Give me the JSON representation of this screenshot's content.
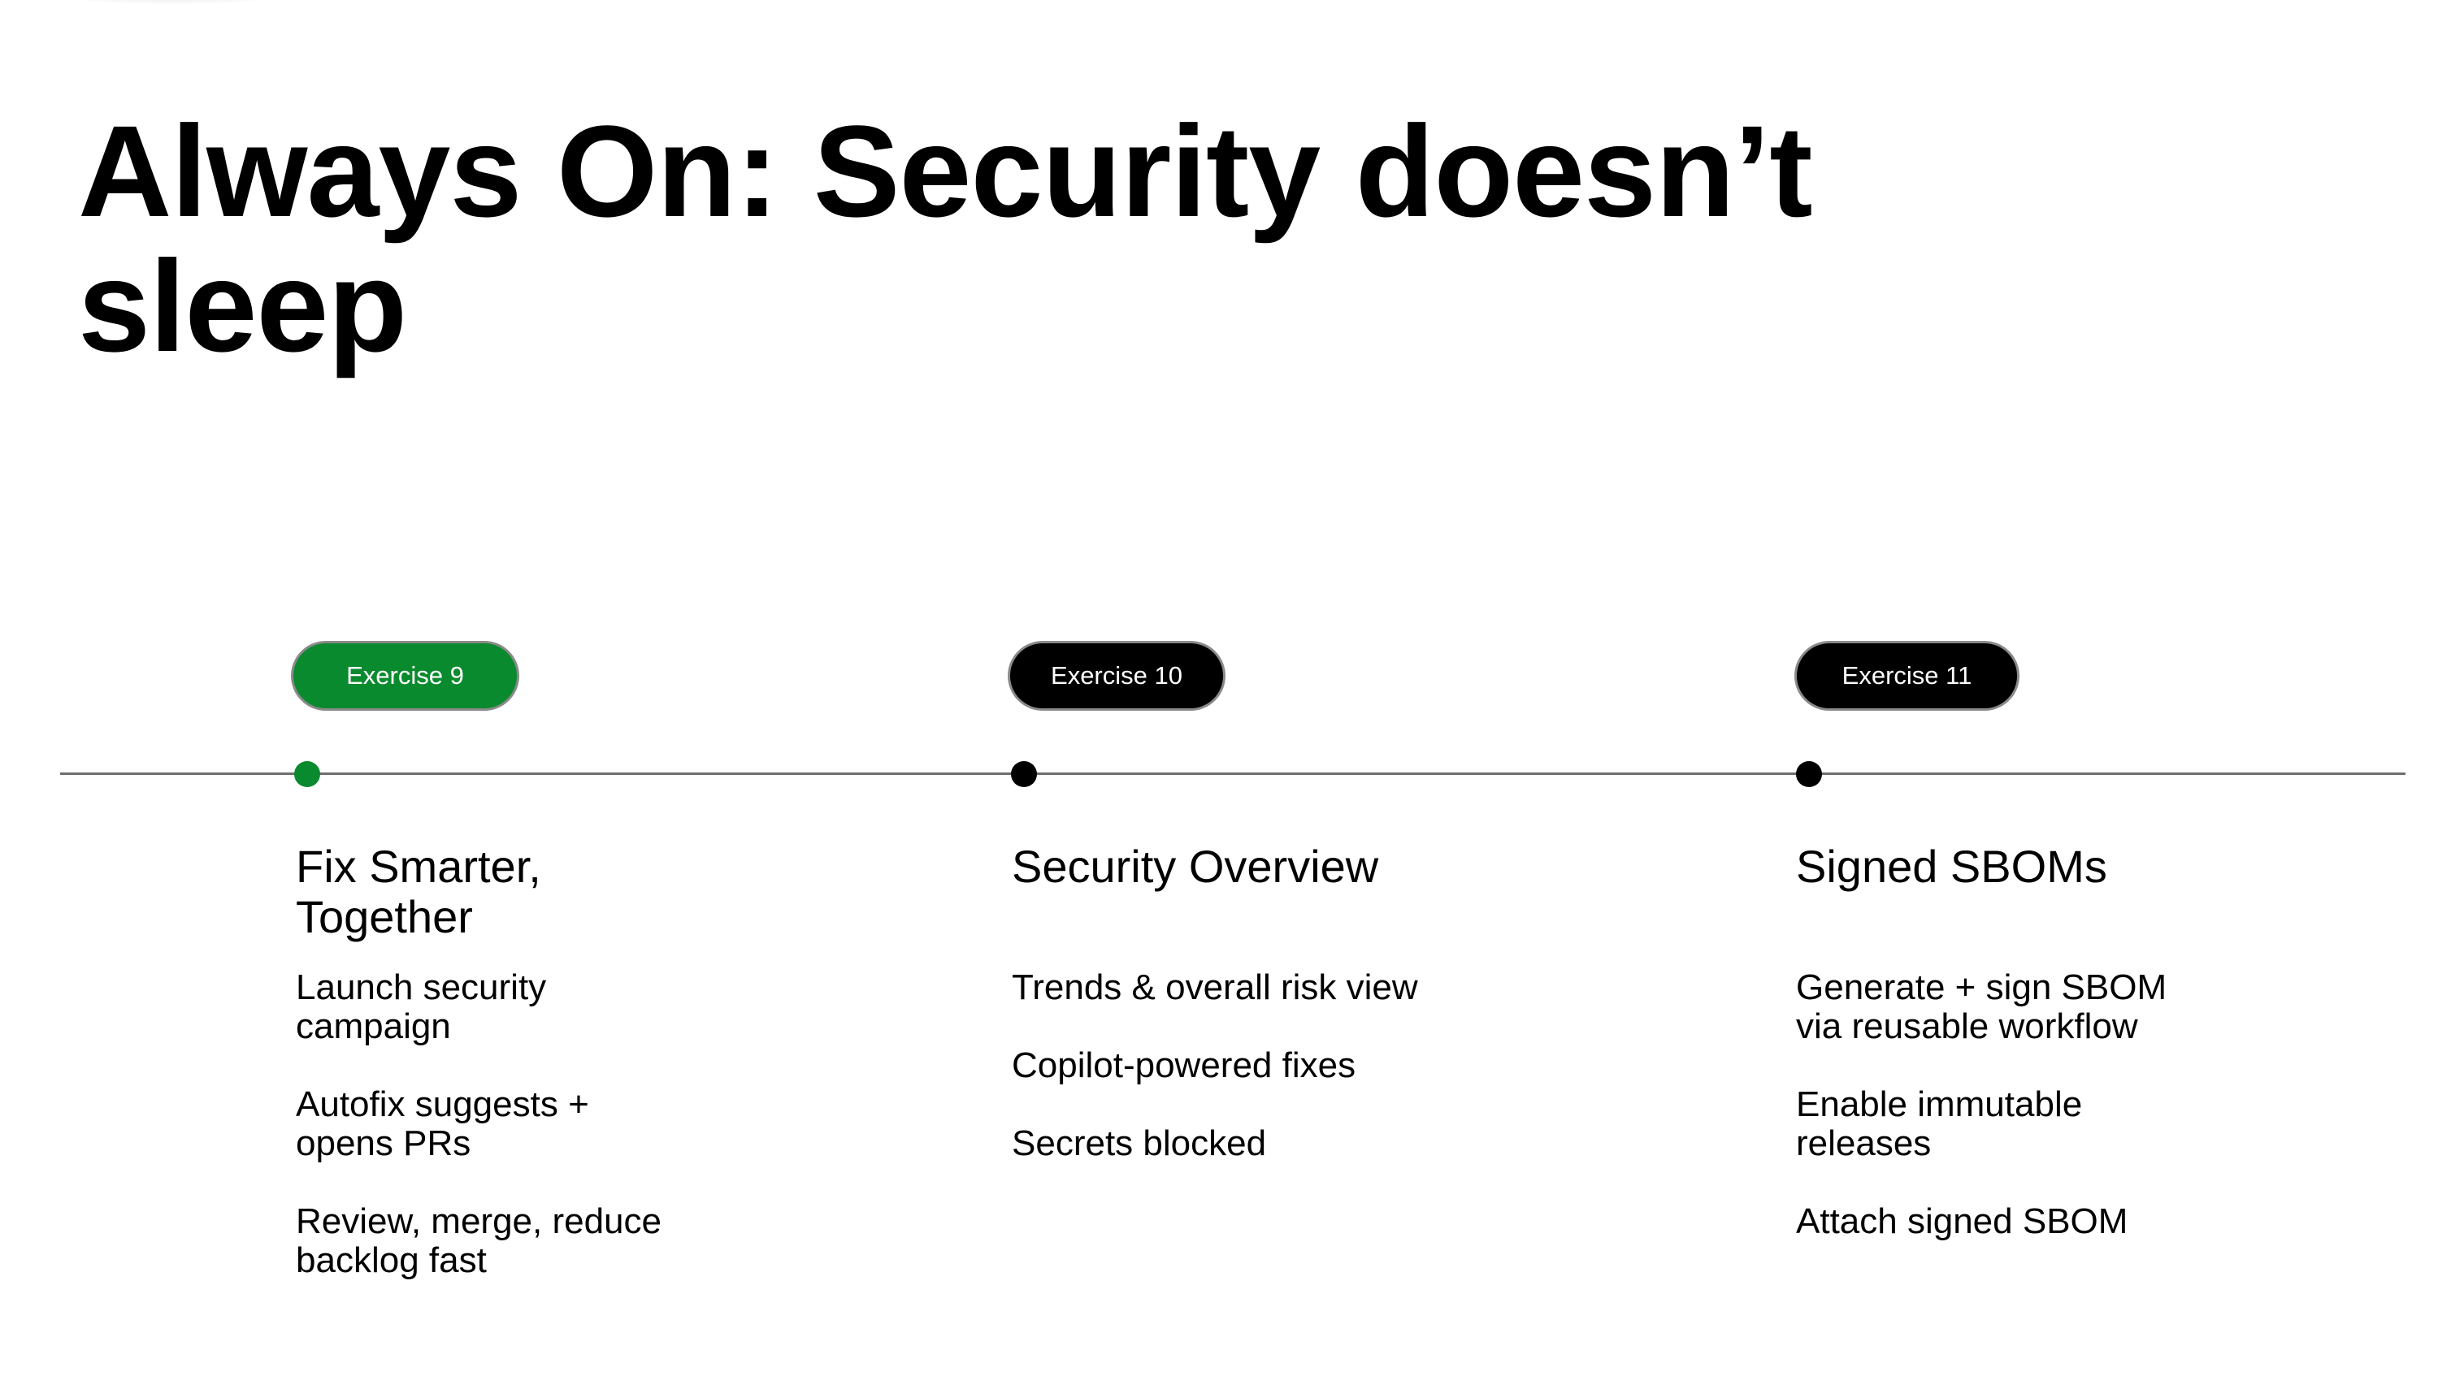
{
  "title": "Always On: Security doesn’t sleep",
  "colors": {
    "active": "#0a8a2e",
    "inactive": "#000000",
    "line": "#6e6e6e"
  },
  "columns": [
    {
      "badge": "Exercise 9",
      "status": "active",
      "heading": "Fix Smarter, Together",
      "bullets": [
        "Launch security campaign",
        "Autofix suggests + opens PRs",
        "Review, merge, reduce backlog fast"
      ]
    },
    {
      "badge": "Exercise 10",
      "status": "inactive",
      "heading": "Security Overview",
      "bullets": [
        "Trends & overall risk view",
        "Copilot-powered fixes",
        "Secrets blocked"
      ]
    },
    {
      "badge": "Exercise 11",
      "status": "inactive",
      "heading": "Signed SBOMs",
      "bullets": [
        "Generate + sign SBOM via reusable workflow",
        "Enable immutable releases",
        "Attach signed SBOM"
      ]
    }
  ]
}
